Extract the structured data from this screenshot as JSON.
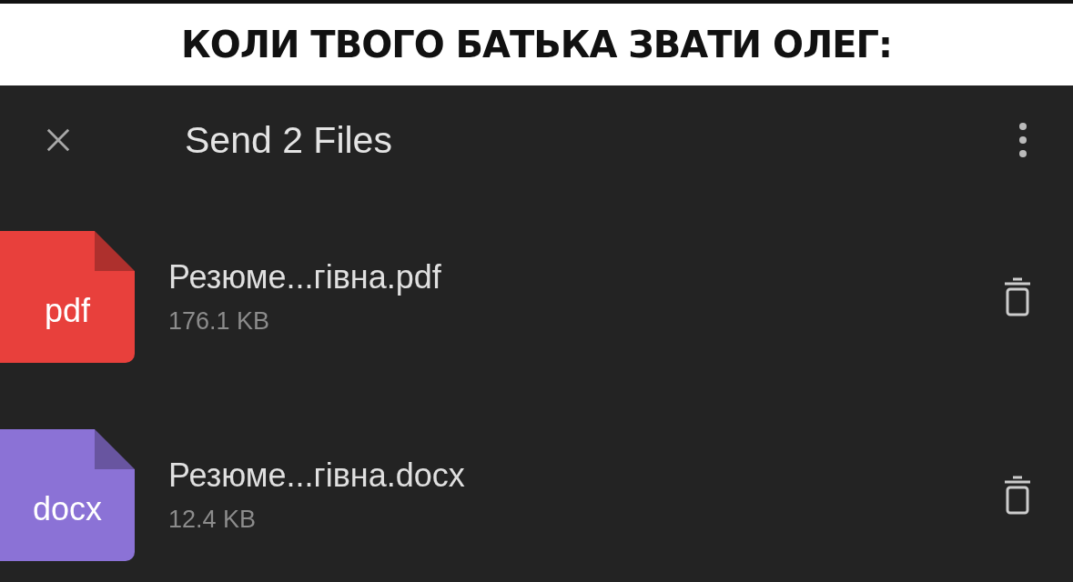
{
  "caption": "КОЛИ ТВОГО БАТЬКА ЗВАТИ ОЛЕГ:",
  "header": {
    "title": "Send 2 Files"
  },
  "files": [
    {
      "badge": "pdf",
      "color": "#e8403c",
      "name": "Резюме...гівна.pdf",
      "size": "176.1 KB"
    },
    {
      "badge": "docx",
      "color": "#8b72d6",
      "name": "Резюме...гівна.docx",
      "size": "12.4 KB"
    }
  ]
}
